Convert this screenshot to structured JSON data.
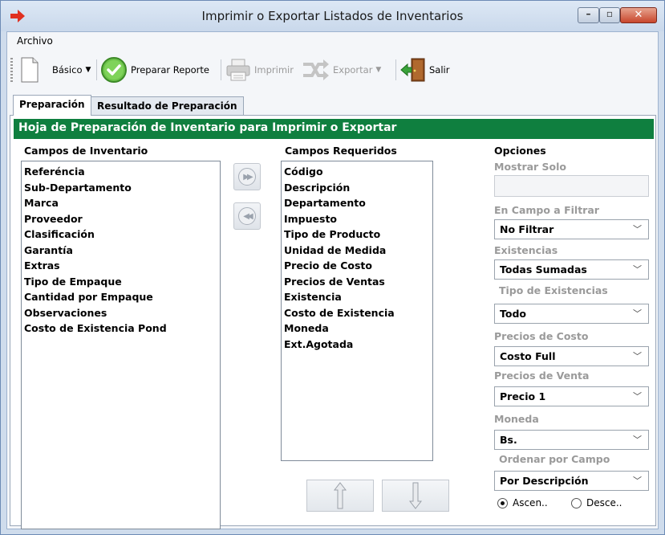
{
  "window": {
    "title": "Imprimir o Exportar Listados de Inventarios"
  },
  "menu": {
    "archivo": "Archivo"
  },
  "toolbar": {
    "basico": "Básico",
    "preparar": "Preparar Reporte",
    "imprimir": "Imprimir",
    "exportar": "Exportar",
    "salir": "Salir"
  },
  "tabs": [
    {
      "label": "Preparación",
      "active": true
    },
    {
      "label": "Resultado de Preparación",
      "active": false
    }
  ],
  "panel": {
    "header": "Hoja de Preparación de Inventario para Imprimir o Exportar"
  },
  "campos_inventario": {
    "title": "Campos de Inventario",
    "items": [
      "Referéncia",
      "Sub-Departamento",
      "Marca",
      "Proveedor",
      "Clasificación",
      "Garantía",
      "Extras",
      "Tipo de Empaque",
      "Cantidad por Empaque",
      "Observaciones",
      "Costo de Existencia Pond"
    ]
  },
  "campos_requeridos": {
    "title": "Campos Requeridos",
    "items": [
      "Código",
      "Descripción",
      "Departamento",
      "Impuesto",
      "Tipo de Producto",
      "Unidad de Medida",
      "Precio de Costo",
      "Precios de Ventas",
      "Existencia",
      "Costo de Existencia",
      "Moneda",
      "Ext.Agotada"
    ]
  },
  "opciones": {
    "title": "Opciones",
    "mostrar_solo": {
      "label": "Mostrar Solo",
      "value": ""
    },
    "campo_filtrar": {
      "label": "En Campo a Filtrar",
      "value": "No Filtrar"
    },
    "existencias": {
      "label": "Existencias",
      "value": "Todas Sumadas"
    },
    "tipo_existencias": {
      "label": "Tipo de Existencias",
      "value": "Todo"
    },
    "precios_costo": {
      "label": "Precios de Costo",
      "value": "Costo Full"
    },
    "precios_venta": {
      "label": "Precios de Venta",
      "value": "Precio 1"
    },
    "moneda": {
      "label": "Moneda",
      "value": "Bs."
    },
    "ordenar": {
      "label": "Ordenar por Campo",
      "value": "Por Descripción"
    },
    "asc_label": "Ascen..",
    "desc_label": "Desce..",
    "order_selected": "Ascen.."
  },
  "colors": {
    "header_green": "#0f7f3f",
    "disabled_text": "#9a9a9a"
  }
}
